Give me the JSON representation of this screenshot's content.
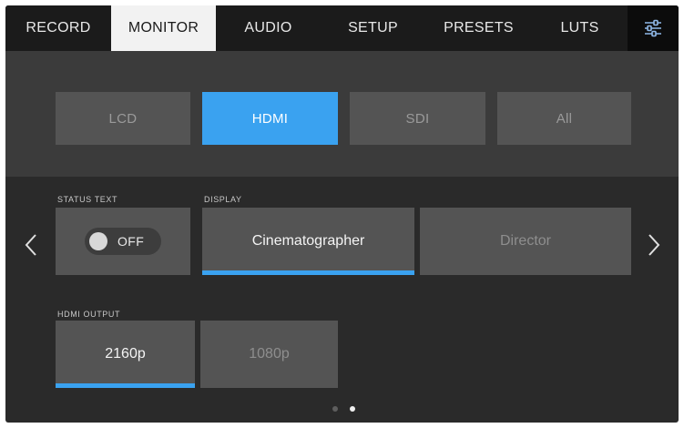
{
  "tabs": [
    {
      "label": "RECORD",
      "active": false
    },
    {
      "label": "MONITOR",
      "active": true
    },
    {
      "label": "AUDIO",
      "active": false
    },
    {
      "label": "SETUP",
      "active": false
    },
    {
      "label": "PRESETS",
      "active": false
    },
    {
      "label": "LUTS",
      "active": false
    }
  ],
  "settings_icon": "sliders-icon",
  "monitor_outputs": {
    "items": [
      "LCD",
      "HDMI",
      "SDI",
      "All"
    ],
    "selected": "HDMI"
  },
  "status_text": {
    "label": "STATUS TEXT",
    "toggle_state": "OFF"
  },
  "display": {
    "label": "DISPLAY",
    "options": [
      "Cinematographer",
      "Director"
    ],
    "selected": "Cinematographer"
  },
  "hdmi_output": {
    "label": "HDMI OUTPUT",
    "options": [
      "2160p",
      "1080p"
    ],
    "selected": "2160p"
  },
  "pagination": {
    "total_pages": 2,
    "current_page": 2
  },
  "colors": {
    "accent": "#3aa2f0",
    "tab_bar": "#1b1b1b",
    "active_tab": "#f2f2f2",
    "panel": "#2a2a2a",
    "band": "#3b3b3b",
    "button": "#545454"
  }
}
